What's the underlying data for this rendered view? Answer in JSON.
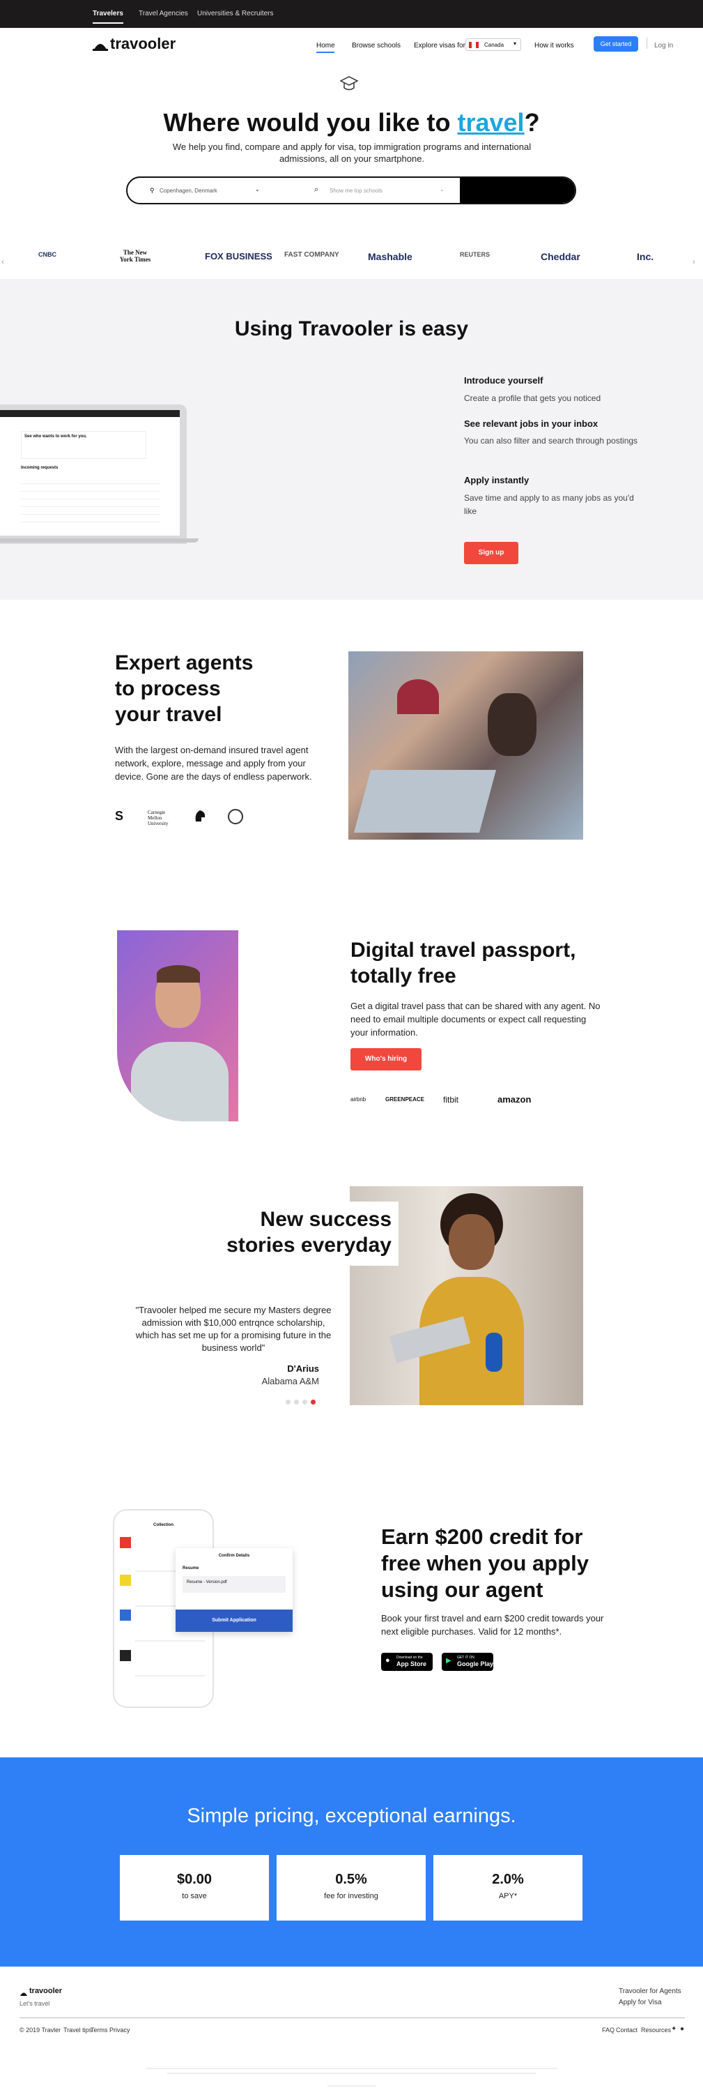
{
  "topnav": {
    "tabs": [
      "Travelers",
      "Travel Agencies",
      "Universities & Recruiters"
    ]
  },
  "header": {
    "logo": "travooler",
    "nav": [
      "Home",
      "Browse schools",
      "Explore visas for",
      "How it works"
    ],
    "country": "Canada",
    "cta": "Get started",
    "login": "Log in"
  },
  "hero": {
    "title_pre": "Where would you like to ",
    "title_link": "travel",
    "title_post": "?",
    "subtitle": "We help you find, compare and apply for visa, top immigration programs and international admissions, all on your smartphone.",
    "location_value": "Copenhagen, Denmark",
    "search_placeholder": "Show me top schools"
  },
  "press": {
    "logos": [
      "CNBC",
      "The New York Times",
      "FOX BUSINESS",
      "FAST COMPANY",
      "Mashable",
      "REUTERS",
      "Cheddar",
      "Inc."
    ]
  },
  "easy": {
    "title": "Using Travooler is easy",
    "steps": [
      {
        "title": "Introduce yourself",
        "desc": "Create a profile that gets you noticed"
      },
      {
        "title": "See relevant jobs in your inbox",
        "desc": "You can also filter and search through postings"
      },
      {
        "title": "Apply instantly",
        "desc": "Save time and apply to as many jobs as you'd like"
      }
    ],
    "cta": "Sign up",
    "mock": {
      "headline": "See who wants to work for you.",
      "section": "Incoming requests"
    }
  },
  "agents": {
    "title": [
      "Expert agents",
      "to process",
      "your travel"
    ],
    "desc": "With the largest on-demand insured travel agent network, explore, message and apply from your device. Gone are the days of endless paperwork.",
    "logos": [
      "S",
      "Carnegie Mellon University",
      "MSU",
      "seal"
    ]
  },
  "passport": {
    "title": [
      "Digital travel passport,",
      "totally free"
    ],
    "desc": "Get a digital travel pass that can be shared with any agent. No need to email multiple documents or expect call requesting your information.",
    "cta": "Who's hiring",
    "logos": [
      "airbnb",
      "GREENPEACE",
      "fitbit",
      "amazon"
    ]
  },
  "stories": {
    "title": [
      "New success",
      "stories everyday"
    ],
    "quote": "\"Travooler helped me secure my Masters degree admission with $10,000 entrqnce scholarship, which has set me up for a promising future in the business world\"",
    "name": "D'Arius",
    "school": "Alabama A&M"
  },
  "credit": {
    "title": [
      "Earn $200 credit for",
      "free when you apply",
      "using our agent"
    ],
    "desc": "Book your first travel and earn $200 credit towards your next eligible purchases. Valid for 12 months*.",
    "appstore_small": "Download on the",
    "appstore": "App Store",
    "googleplay_small": "GET IT ON",
    "googleplay": "Google Play",
    "phone_title": "Collection",
    "modal_title": "Confirm Details",
    "modal_resume": "Resume",
    "modal_file": "Resume - Version.pdf",
    "modal_submit": "Submit Application"
  },
  "pricing": {
    "title": "Simple pricing, exceptional earnings.",
    "cards": [
      {
        "value": "$0.00",
        "label": "to save"
      },
      {
        "value": "0.5%",
        "label": "fee for investing"
      },
      {
        "value": "2.0%",
        "label": "APY*"
      }
    ]
  },
  "footer": {
    "logo": "travooler",
    "tagline": "Let's travel",
    "links_right": [
      "Travooler for Agents",
      "Apply for Visa"
    ],
    "copyright": "© 2019 Travler",
    "bottom_links": [
      "Travel tips",
      "Terms",
      "Privacy"
    ],
    "bottom_right": [
      "FAQ",
      "Contact",
      "Resources"
    ]
  }
}
